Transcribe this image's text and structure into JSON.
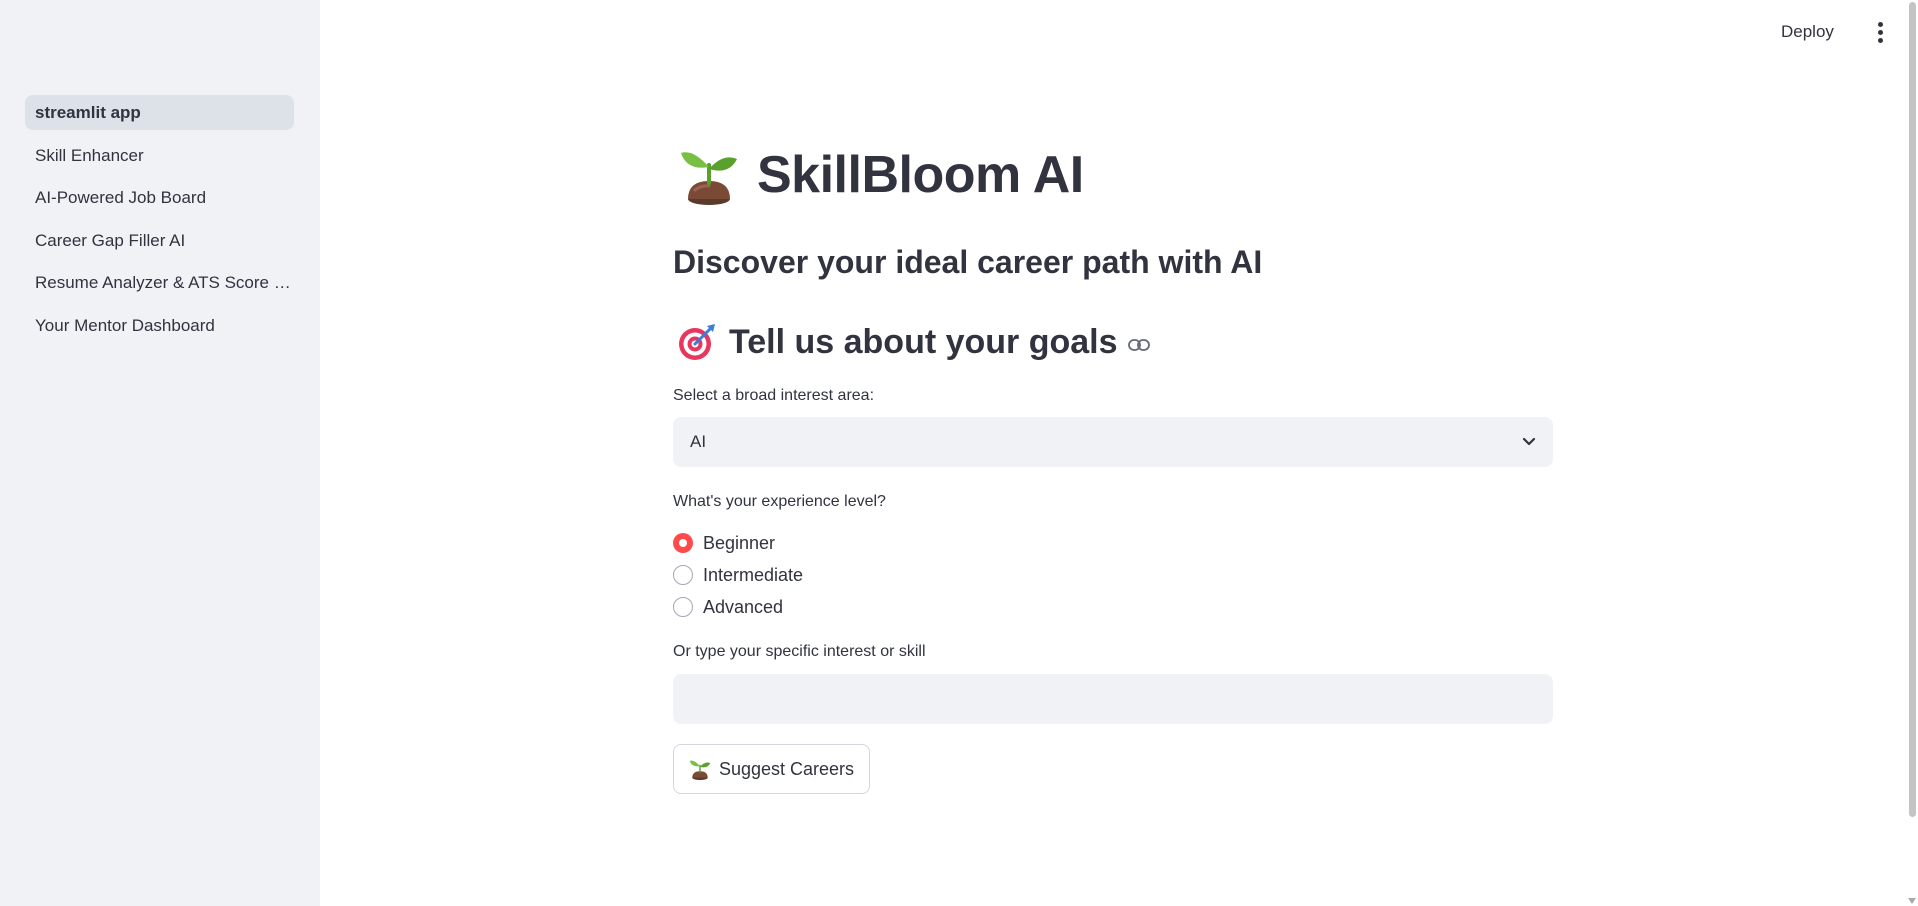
{
  "header": {
    "deploy_label": "Deploy",
    "menu_icon": "more-vertical-icon"
  },
  "sidebar": {
    "items": [
      {
        "label": "streamlit app",
        "active": true
      },
      {
        "label": "Skill Enhancer",
        "active": false
      },
      {
        "label": "AI-Powered Job Board",
        "active": false
      },
      {
        "label": "Career Gap Filler AI",
        "active": false
      },
      {
        "label": "Resume Analyzer & ATS Score Checker",
        "active": false
      },
      {
        "label": "Your Mentor Dashboard",
        "active": false
      }
    ]
  },
  "main": {
    "title": "SkillBloom AI",
    "title_icon": "seedling-icon",
    "subtitle": "Discover your ideal career path with AI",
    "section_heading": "Tell us about your goals",
    "section_icon": "target-icon",
    "interest_select": {
      "label": "Select a broad interest area:",
      "value": "AI"
    },
    "experience": {
      "label": "What's your experience level?",
      "options": [
        "Beginner",
        "Intermediate",
        "Advanced"
      ],
      "selected": "Beginner"
    },
    "specific_interest": {
      "label": "Or type your specific interest or skill",
      "value": "",
      "placeholder": ""
    },
    "suggest_button": {
      "label": "Suggest Careers",
      "icon": "seedling-icon"
    }
  },
  "colors": {
    "sidebar_bg": "#f0f2f6",
    "accent": "#ff4b4b",
    "text": "#31333f",
    "input_bg": "#f0f2f6"
  }
}
